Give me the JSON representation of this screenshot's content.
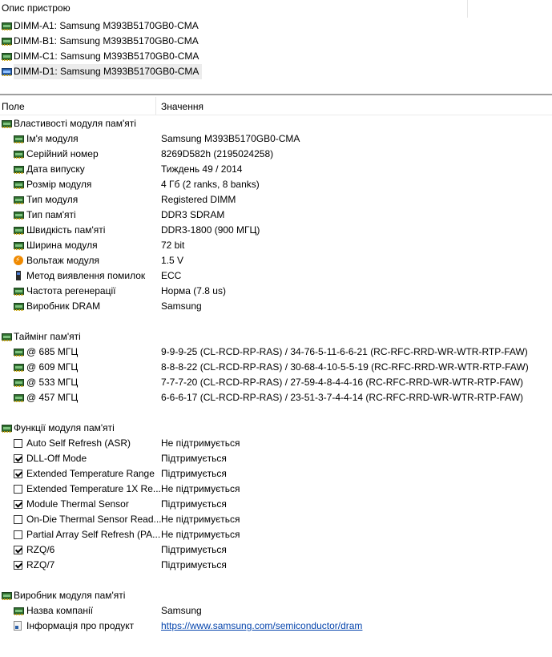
{
  "device_panel": {
    "title": "Опис пристрою",
    "devices": [
      {
        "label": "DIMM-A1: Samsung M393B5170GB0-CMA",
        "icon": "memory-module-icon"
      },
      {
        "label": "DIMM-B1: Samsung M393B5170GB0-CMA",
        "icon": "memory-module-icon"
      },
      {
        "label": "DIMM-C1: Samsung M393B5170GB0-CMA",
        "icon": "memory-module-icon"
      },
      {
        "label": "DIMM-D1: Samsung M393B5170GB0-CMA",
        "icon": "memory-module-icon-selected",
        "selected": true
      }
    ]
  },
  "columns": {
    "field": "Поле",
    "value": "Значення"
  },
  "sections": {
    "properties": {
      "title": "Властивості модуля пам'яті",
      "rows": [
        {
          "field": "Ім'я модуля",
          "value": "Samsung M393B5170GB0-CMA"
        },
        {
          "field": "Серійний номер",
          "value": "8269D582h (2195024258)"
        },
        {
          "field": "Дата випуску",
          "value": "Тиждень 49 / 2014"
        },
        {
          "field": "Розмір модуля",
          "value": "4 Гб (2 ranks, 8 banks)"
        },
        {
          "field": "Тип модуля",
          "value": "Registered DIMM"
        },
        {
          "field": "Тип пам'яті",
          "value": "DDR3 SDRAM"
        },
        {
          "field": "Швидкість пам'яті",
          "value": "DDR3-1800 (900 МГЦ)"
        },
        {
          "field": "Ширина модуля",
          "value": "72 bit"
        },
        {
          "field": "Вольтаж модуля",
          "value": "1.5 V"
        },
        {
          "field": "Метод виявлення помилок",
          "value": "ECC"
        },
        {
          "field": "Частота регенерації",
          "value": "Норма (7.8 us)"
        },
        {
          "field": "Виробник DRAM",
          "value": "Samsung"
        }
      ]
    },
    "timing": {
      "title": "Таймінг пам'яті",
      "rows": [
        {
          "field": "@ 685 МГЦ",
          "value": "9-9-9-25  (CL-RCD-RP-RAS) / 34-76-5-11-6-6-21  (RC-RFC-RRD-WR-WTR-RTP-FAW)"
        },
        {
          "field": "@ 609 МГЦ",
          "value": "8-8-8-22  (CL-RCD-RP-RAS) / 30-68-4-10-5-5-19  (RC-RFC-RRD-WR-WTR-RTP-FAW)"
        },
        {
          "field": "@ 533 МГЦ",
          "value": "7-7-7-20  (CL-RCD-RP-RAS) / 27-59-4-8-4-4-16  (RC-RFC-RRD-WR-WTR-RTP-FAW)"
        },
        {
          "field": "@ 457 МГЦ",
          "value": "6-6-6-17  (CL-RCD-RP-RAS) / 23-51-3-7-4-4-14  (RC-RFC-RRD-WR-WTR-RTP-FAW)"
        }
      ]
    },
    "features": {
      "title": "Функції модуля пам'яті",
      "rows": [
        {
          "field": "Auto Self Refresh (ASR)",
          "value": "Не підтримується",
          "checked": false
        },
        {
          "field": "DLL-Off Mode",
          "value": "Підтримується",
          "checked": true
        },
        {
          "field": "Extended Temperature Range",
          "value": "Підтримується",
          "checked": true
        },
        {
          "field": "Extended Temperature 1X Re...",
          "value": "Не підтримується",
          "checked": false
        },
        {
          "field": "Module Thermal Sensor",
          "value": "Підтримується",
          "checked": true
        },
        {
          "field": "On-Die Thermal Sensor Read...",
          "value": "Не підтримується",
          "checked": false
        },
        {
          "field": "Partial Array Self Refresh (PA...",
          "value": "Не підтримується",
          "checked": false
        },
        {
          "field": "RZQ/6",
          "value": "Підтримується",
          "checked": true
        },
        {
          "field": "RZQ/7",
          "value": "Підтримується",
          "checked": true
        }
      ]
    },
    "manufacturer": {
      "title": "Виробник модуля пам'яті",
      "rows": [
        {
          "field": "Назва компанії",
          "value": "Samsung"
        },
        {
          "field": "Інформація про продукт",
          "value": "https://www.samsung.com/semiconductor/dram"
        }
      ]
    }
  }
}
